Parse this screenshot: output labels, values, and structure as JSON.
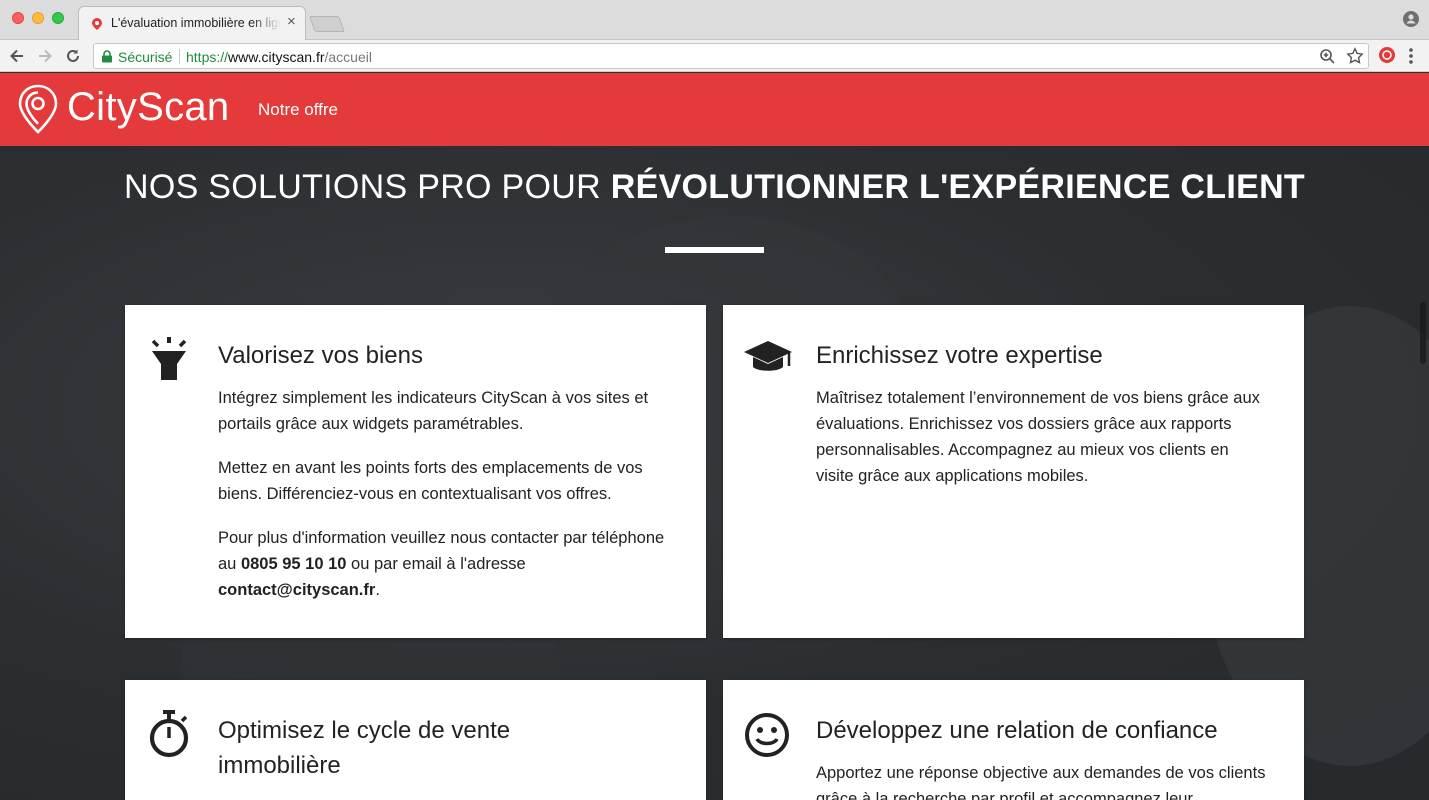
{
  "browser": {
    "tab_title": "L'évaluation immobilière en ligne",
    "tab_close": "×",
    "secure_label": "Sécurisé",
    "url_scheme": "https://",
    "url_host": "www.cityscan.fr",
    "url_path": "/accueil",
    "icons": [
      "back-arrow-icon",
      "forward-arrow-icon",
      "reload-icon",
      "lock-icon",
      "zoom-icon",
      "star-icon",
      "extension-icon",
      "menu-icon",
      "profile-icon"
    ]
  },
  "header": {
    "logo_text": "CityScan",
    "nav_offer": "Notre offre",
    "brand_color": "#e53a3b"
  },
  "hero": {
    "title_light": "NOS SOLUTIONS PRO POUR",
    "title_bold": "RÉVOLUTIONNER L'EXPÉRIENCE CLIENT"
  },
  "cards": [
    {
      "icon": "lamp-icon",
      "title": "Valorisez vos biens",
      "p1": "Intégrez simplement les indicateurs CityScan à vos sites et portails grâce aux widgets paramétrables.",
      "p2": "Mettez en avant les points forts des emplacements de vos biens. Différenciez-vous en contextualisant vos offres.",
      "p3_a": "Pour plus d'information veuillez nous contacter par téléphone au ",
      "phone": "0805 95 10 10",
      "p3_b": " ou par email à l'adresse ",
      "email": "contact@cityscan.fr",
      "p3_c": "."
    },
    {
      "icon": "graduation-cap-icon",
      "title": "Enrichissez votre expertise",
      "p1": "Maîtrisez totalement l’environnement de vos biens grâce aux évaluations. Enrichissez vos dossiers grâce aux rapports personnalisables. Accompagnez au mieux vos clients en visite grâce aux applications mobiles."
    },
    {
      "icon": "stopwatch-icon",
      "title": "Optimisez le cycle de vente immobilière"
    },
    {
      "icon": "smiley-icon",
      "title": "Développez une relation de confiance",
      "p1": "Apportez une réponse objective aux demandes de vos clients grâce à la recherche par profil et accompagnez leur"
    }
  ]
}
